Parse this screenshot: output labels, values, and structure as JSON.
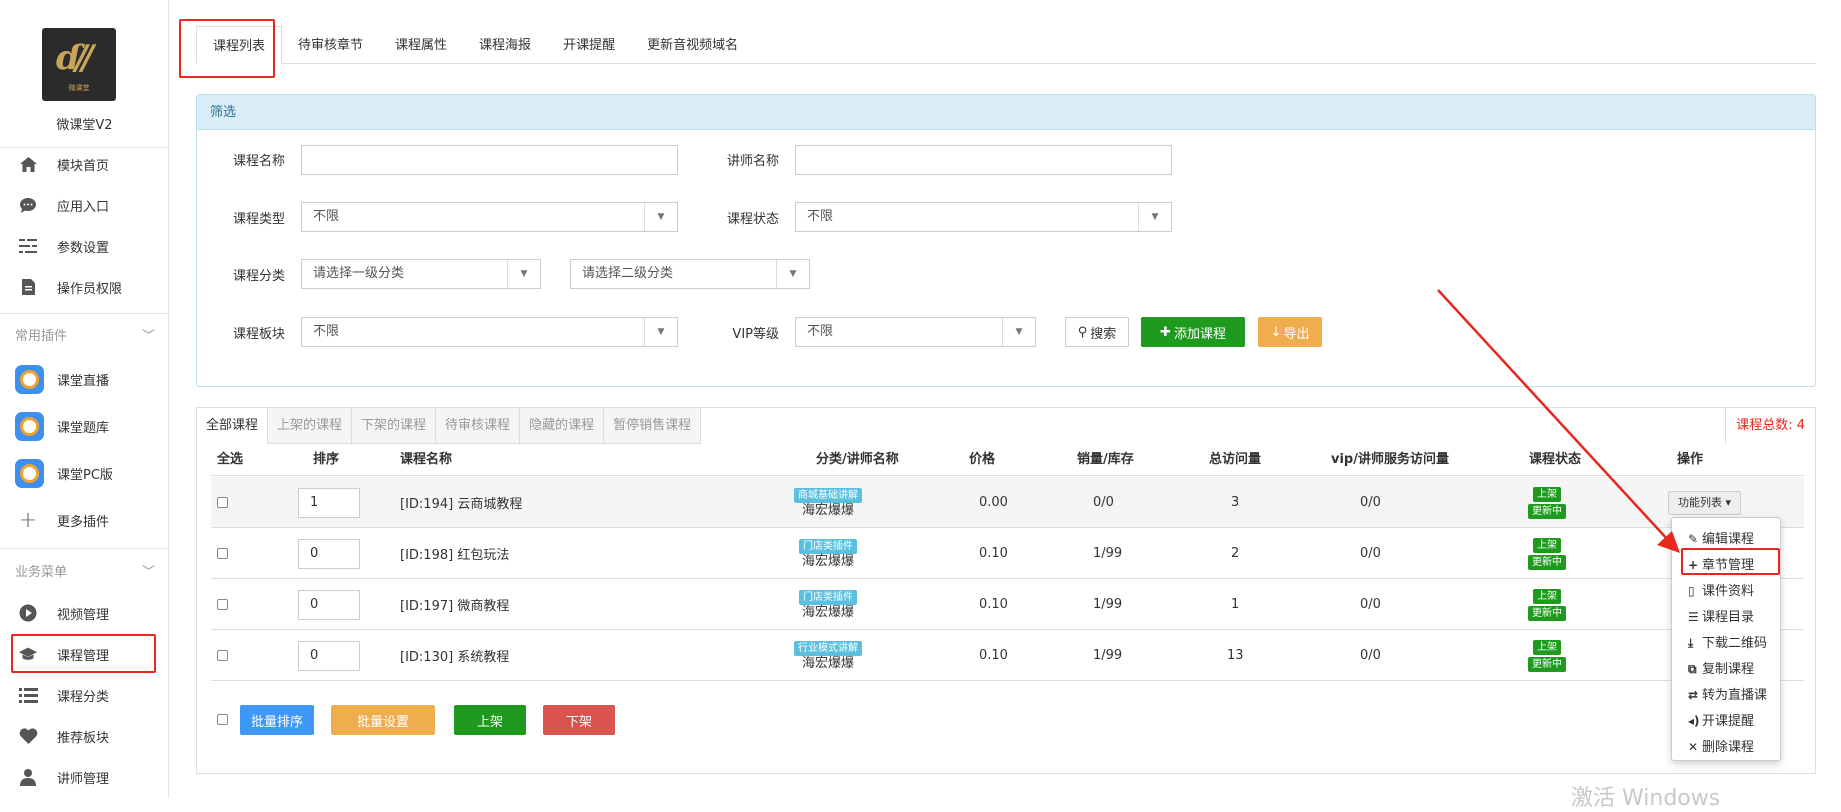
{
  "app": {
    "name": "微课堂V2",
    "logo_sub": "微课堂"
  },
  "sidebar": {
    "items": [
      {
        "label": "模块首页",
        "icon": "home-icon"
      },
      {
        "label": "应用入口",
        "icon": "chat-icon"
      },
      {
        "label": "参数设置",
        "icon": "settings-list-icon"
      },
      {
        "label": "操作员权限",
        "icon": "document-icon"
      }
    ],
    "group_plugins": "常用插件",
    "plugins": [
      {
        "label": "课堂直播",
        "icon": "live-icon"
      },
      {
        "label": "课堂题库",
        "icon": "question-bank-icon"
      },
      {
        "label": "课堂PC版",
        "icon": "pc-icon"
      },
      {
        "label": "更多插件",
        "icon": "plus-icon"
      }
    ],
    "group_business": "业务菜单",
    "business": [
      {
        "label": "视频管理",
        "icon": "play-icon"
      },
      {
        "label": "课程管理",
        "icon": "graduation-cap-icon"
      },
      {
        "label": "课程分类",
        "icon": "list-icon"
      },
      {
        "label": "推荐板块",
        "icon": "heart-icon"
      },
      {
        "label": "讲师管理",
        "icon": "user-icon"
      }
    ]
  },
  "tabs": [
    "课程列表",
    "待审核章节",
    "课程属性",
    "课程海报",
    "开课提醒",
    "更新音视频域名"
  ],
  "filter": {
    "title": "筛选",
    "course_name_label": "课程名称",
    "teacher_name_label": "讲师名称",
    "course_type_label": "课程类型",
    "course_type_value": "不限",
    "course_status_label": "课程状态",
    "course_status_value": "不限",
    "category_label": "课程分类",
    "category1_value": "请选择一级分类",
    "category2_value": "请选择二级分类",
    "block_label": "课程板块",
    "block_value": "不限",
    "vip_label": "VIP等级",
    "vip_value": "不限",
    "search_btn": "搜索",
    "add_btn": "添加课程",
    "export_btn": "导出"
  },
  "list": {
    "tabs": [
      "全部课程",
      "上架的课程",
      "下架的课程",
      "待审核课程",
      "隐藏的课程",
      "暂停销售课程"
    ],
    "total": "课程总数: 4",
    "headers": [
      "全选",
      "排序",
      "课程名称",
      "分类/讲师名称",
      "价格",
      "销量/库存",
      "总访问量",
      "vip/讲师服务访问量",
      "课程状态",
      "操作"
    ],
    "rows": [
      {
        "sort": "1",
        "name": "[ID:194] 云商城教程",
        "category": "商城基础讲解",
        "teacher": "海宏爆爆",
        "price": "0.00",
        "sales": "0/0",
        "visits": "3",
        "vip_visits": "0/0",
        "status1": "上架",
        "status2": "更新中"
      },
      {
        "sort": "0",
        "name": "[ID:198] 红包玩法",
        "category": "门店类插件",
        "teacher": "海宏爆爆",
        "price": "0.10",
        "sales": "1/99",
        "visits": "2",
        "vip_visits": "0/0",
        "status1": "上架",
        "status2": "更新中"
      },
      {
        "sort": "0",
        "name": "[ID:197] 微商教程",
        "category": "门店类插件",
        "teacher": "海宏爆爆",
        "price": "0.10",
        "sales": "1/99",
        "visits": "1",
        "vip_visits": "0/0",
        "status1": "上架",
        "status2": "更新中"
      },
      {
        "sort": "0",
        "name": "[ID:130] 系统教程",
        "category": "行业模式讲解",
        "teacher": "海宏爆爆",
        "price": "0.10",
        "sales": "1/99",
        "visits": "13",
        "vip_visits": "0/0",
        "status1": "上架",
        "status2": "更新中"
      }
    ],
    "func_btn": "功能列表",
    "dropdown": [
      "编辑课程",
      "章节管理",
      "课件资料",
      "课程目录",
      "下载二维码",
      "复制课程",
      "转为直播课",
      "开课提醒",
      "删除课程"
    ],
    "bottom": {
      "batch_sort": "批量排序",
      "batch_set": "批量设置",
      "on_shelf": "上架",
      "off_shelf": "下架"
    }
  },
  "watermark": "激活 Windows",
  "colors": {
    "accent_green": "#1e9b1e",
    "accent_orange": "#f0ad4e",
    "accent_blue": "#3d99f5",
    "danger": "#d9534f",
    "highlight_red": "#e8281e",
    "info_bg": "#d9edf7"
  }
}
